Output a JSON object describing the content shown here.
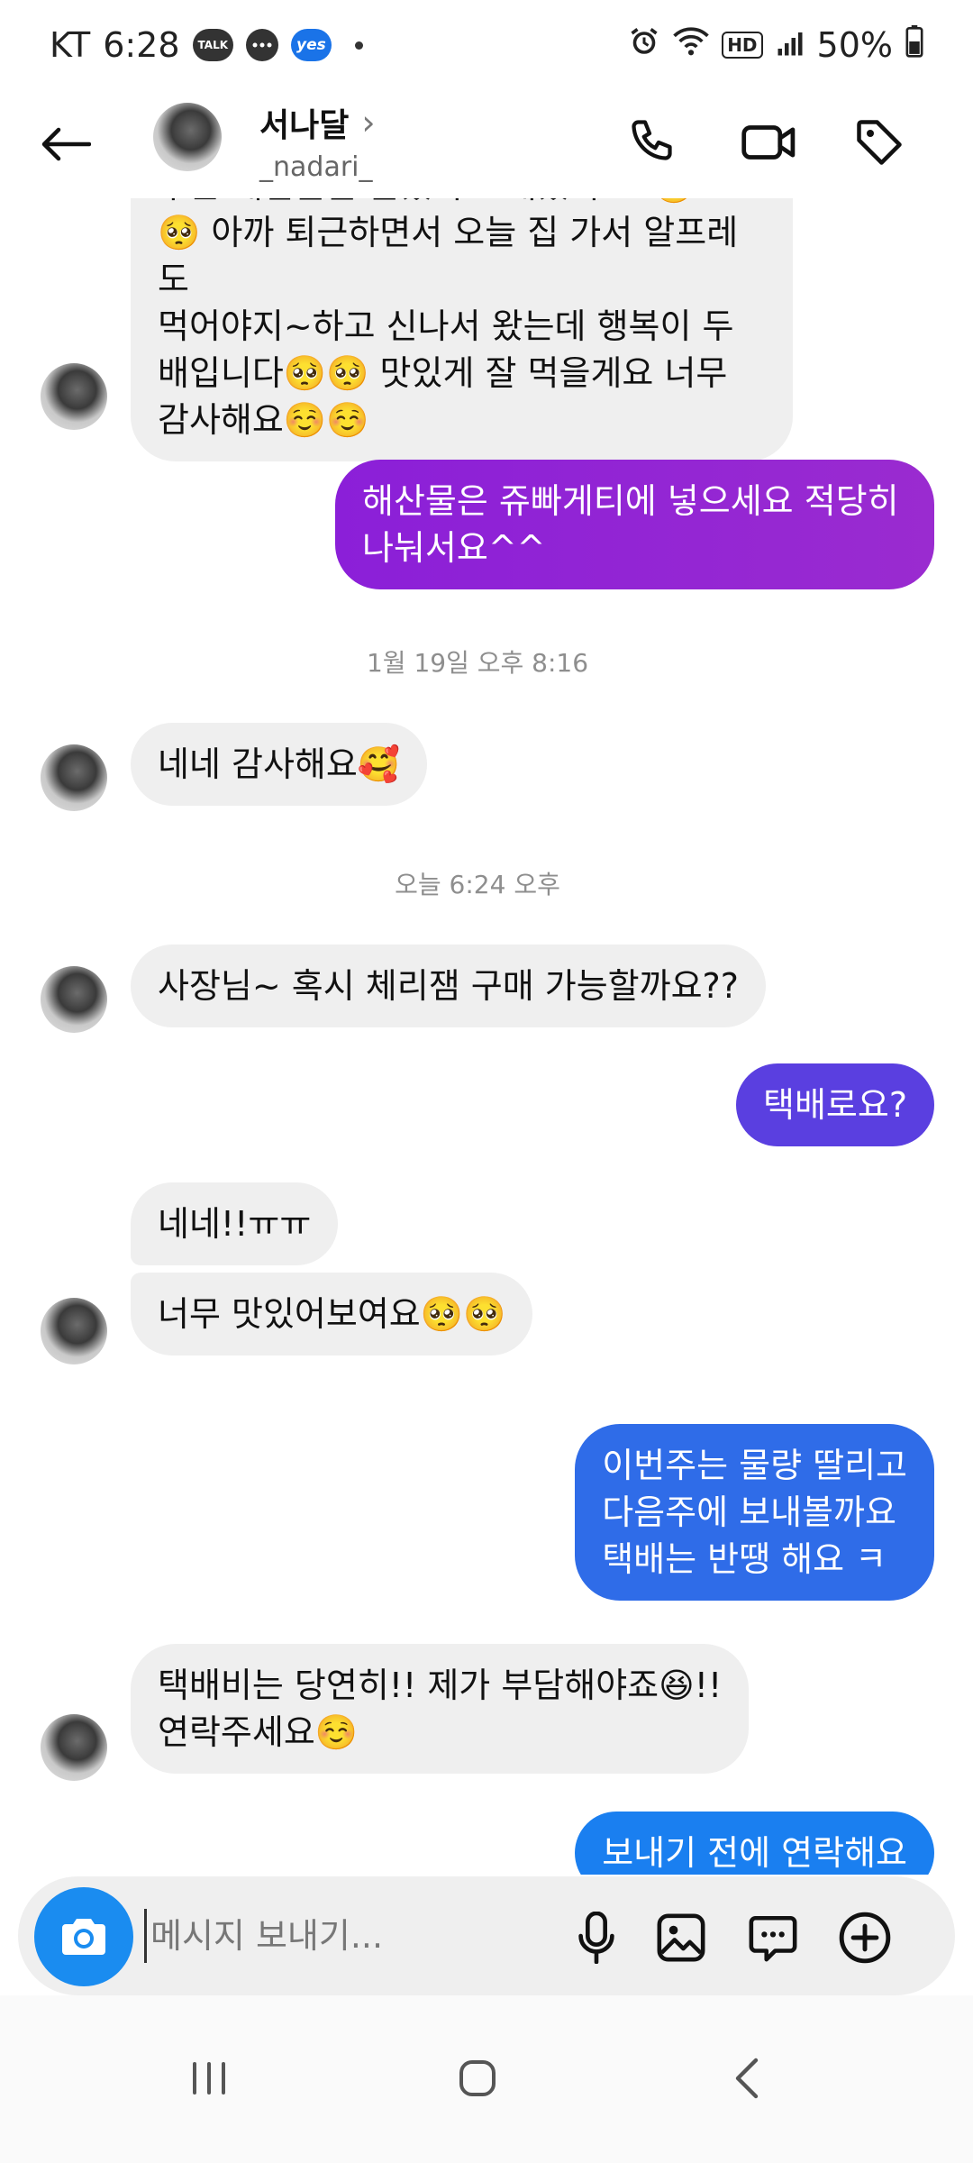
{
  "status_bar": {
    "carrier": "KT",
    "time": "6:28",
    "battery": "50%",
    "hd_label": "HD",
    "badges": [
      "TALK",
      "yes"
    ]
  },
  "header": {
    "name": "서나달",
    "chevron": "›",
    "handle": "_nadari_"
  },
  "messages": [
    {
      "dir": "in",
      "text": "우는 해산물을 들었지 보내셨어요..🥺\n🥺 아까 퇴근하면서 오늘 집 가서 알프레도\n먹어야지~하고 신나서 왔는데 행복이 두\n배입니다🥺🥺 맛있게 잘 먹을게요 너무\n감사해요☺️☺️"
    },
    {
      "dir": "out",
      "text": "해산물은 쥬빠게티에 넣으세요 적당히\n나눠서요^^",
      "color": "#8a22d6"
    },
    {
      "dir": "ts",
      "text": "1월 19일 오후 8:16"
    },
    {
      "dir": "in",
      "text": "네네 감사해요🥰"
    },
    {
      "dir": "ts",
      "text": "오늘 6:24 오후"
    },
    {
      "dir": "in",
      "text": "사장님~ 혹시 체리잼 구매 가능할까요??"
    },
    {
      "dir": "out",
      "text": "택배로요?",
      "color": "#5b3fe0"
    },
    {
      "dir": "in",
      "text": "네네!!ㅠㅠ"
    },
    {
      "dir": "in",
      "text": "너무 맛있어보여요🥺🥺"
    },
    {
      "dir": "out",
      "text": "이번주는 물량 딸리고\n다음주에 보내볼까요\n택배는 반땡 해요 ㅋ",
      "color": "#2f6de8"
    },
    {
      "dir": "in",
      "text": "택배비는 당연히!! 제가 부담해야죠😆!!\n연락주세요☺️"
    },
    {
      "dir": "out",
      "text": "보내기 전에 연락해요",
      "color": "#1a7ff0"
    }
  ],
  "composer": {
    "placeholder": "메시지 보내기..."
  },
  "icons": {
    "back": "back-arrow-icon",
    "call": "phone-icon",
    "video": "video-camera-icon",
    "tag": "tag-icon",
    "camera": "camera-icon",
    "mic": "microphone-icon",
    "gallery": "image-icon",
    "sticker": "chat-bubble-icon",
    "add": "plus-circle-icon"
  }
}
